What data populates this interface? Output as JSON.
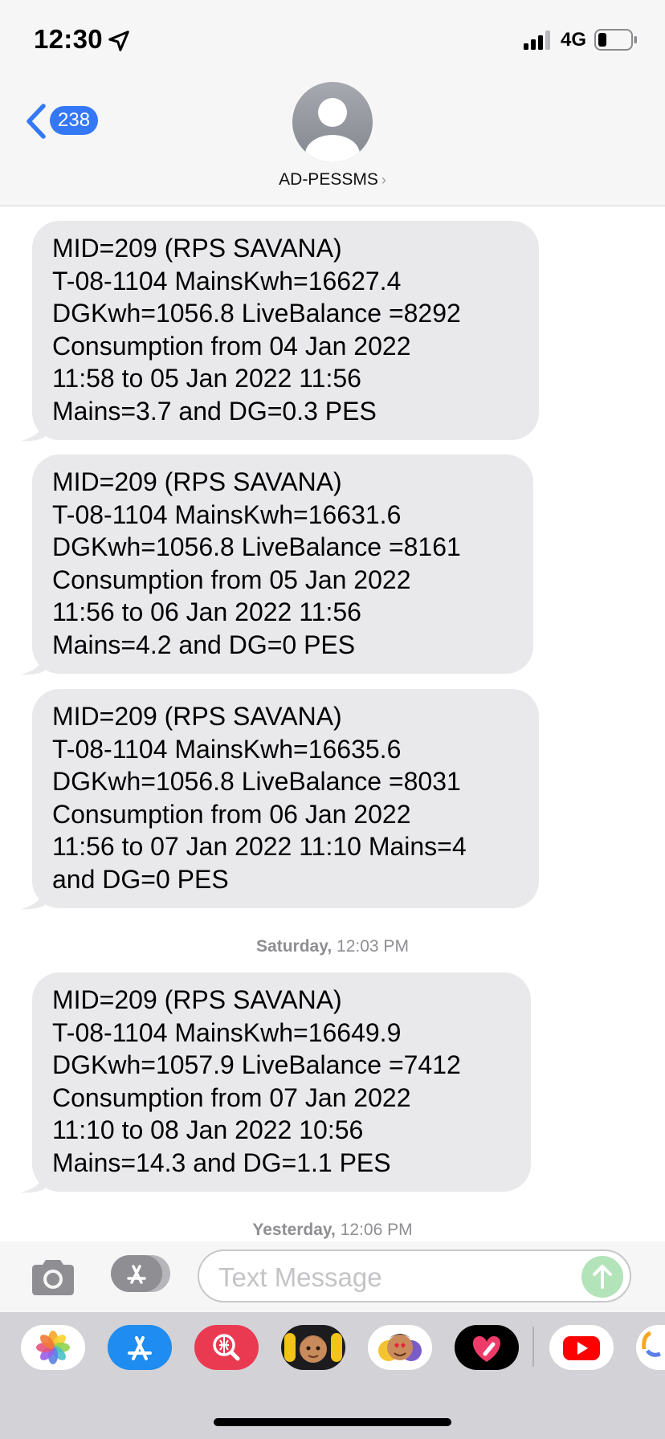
{
  "status_bar": {
    "time": "12:30",
    "network": "4G"
  },
  "header": {
    "back_badge_count": "238",
    "contact_name": "AD-PESSMS",
    "contact_chevron": "›"
  },
  "messages": [
    {
      "lines": [
        "MID=209 (RPS SAVANA)",
        "T-08-1104 MainsKwh=16627.4",
        "DGKwh=1056.8 LiveBalance =8292",
        "Consumption from 04 Jan 2022",
        "11:58 to 05 Jan 2022 11:56",
        "Mains=3.7 and DG=0.3 PES"
      ]
    },
    {
      "lines": [
        "MID=209 (RPS SAVANA)",
        "T-08-1104 MainsKwh=16631.6",
        "DGKwh=1056.8 LiveBalance =8161",
        "Consumption from 05 Jan 2022",
        "11:56 to 06 Jan 2022 11:56",
        "Mains=4.2 and DG=0 PES"
      ]
    },
    {
      "lines": [
        "MID=209 (RPS SAVANA)",
        "T-08-1104 MainsKwh=16635.6",
        "DGKwh=1056.8 LiveBalance =8031",
        "Consumption from 06 Jan 2022",
        "11:56 to 07 Jan 2022 11:10 Mains=4",
        "and DG=0 PES"
      ]
    },
    {
      "lines": [
        "MID=209 (RPS SAVANA)",
        "T-08-1104 MainsKwh=16649.9",
        "DGKwh=1057.9 LiveBalance =7412",
        "Consumption from 07 Jan 2022",
        "11:10 to 08 Jan 2022 10:56",
        "Mains=14.3 and DG=1.1 PES"
      ]
    }
  ],
  "timestamps": [
    {
      "day": "Saturday,",
      "time": "12:03 PM"
    },
    {
      "day": "Yesterday,",
      "time": "12:06 PM"
    }
  ],
  "composer": {
    "placeholder": "Text Message"
  },
  "icons": {
    "location": "location-arrow-icon",
    "signal": "cellular-signal-icon",
    "battery": "battery-icon",
    "back": "chevron-left-icon",
    "avatar": "person-avatar-icon",
    "camera": "camera-icon",
    "apps": "app-store-icon",
    "send": "send-arrow-up-icon"
  },
  "app_drawer": [
    "photos-app-icon",
    "app-store-app-icon",
    "web-search-app-icon",
    "memoji-stickers-app-icon",
    "animoji-stickers-app-icon",
    "digital-touch-app-icon",
    "youtube-app-icon",
    "partial-app-icon"
  ],
  "colors": {
    "accent_blue": "#3478f6",
    "bubble_gray": "#e9e9eb",
    "send_green_disabled": "#b3e3b9",
    "header_bg": "#f6f6f7",
    "drawer_bg": "#d2d2d7"
  }
}
